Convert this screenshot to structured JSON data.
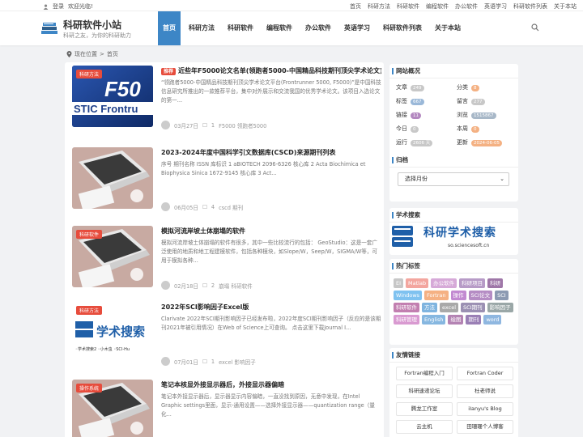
{
  "topbar": {
    "login": "登录",
    "welcome": "欢迎光临!",
    "links": [
      "首页",
      "科研方法",
      "科研软件",
      "编程软件",
      "办公软件",
      "英语学习",
      "科研软件列表",
      "关于本站"
    ]
  },
  "site": {
    "title": "科研软件小站",
    "subtitle": "科研之友，为你的科研助力"
  },
  "nav": [
    "首页",
    "科研方法",
    "科研软件",
    "编程软件",
    "办公软件",
    "英语学习",
    "科研软件列表",
    "关于本站"
  ],
  "breadcrumb": {
    "label": "现在位置",
    "current": "首页"
  },
  "posts": [
    {
      "cat": "科研方法",
      "badge": "推荐",
      "title": "近些年F5000论文名单(领跑者5000-中国精品科技期刊顶尖学术论文)",
      "excerpt": "“领跑者5000-中国精品科技期刊顶尖学术论文平台(Frontrunner 5000, F5000)”是中国科技信息研究所推出的一款推荐平台，集中对外展示和交流我国的优秀学术论文。该项目入选论文的第一...",
      "date": "03月27日",
      "comments": "1",
      "tags": "F5000  领跑者5000",
      "thumb": "f5000"
    },
    {
      "cat": "",
      "badge": "",
      "title": "2023-2024年度中国科学引文数据库(CSCD)来源期刊列表",
      "excerpt": "序号 期刊名称 ISSN 库标识 1 aBIOTECH 2096-6326 核心库 2 Acta Biochimica et Biophysica Sinica 1672-9145 核心库 3 Act...",
      "date": "06月05日",
      "comments": "4",
      "tags": "cscd  期刊",
      "thumb": "laptop"
    },
    {
      "cat": "科研软件",
      "badge": "",
      "title": "模拟河流岸坡土体崩塌的软件",
      "excerpt": "模拟河流岸坡土体崩塌的软件有很多，其中一些比较流行的包括： GeoStudio：这是一套广泛使用的地质和地工程建模软件，包括各种模块，如Slope/W，Seep/W，SIGMA/W等，可用于模拟各种...",
      "date": "02月18日",
      "comments": "2",
      "tags": "崩塌  科研软件",
      "thumb": "laptop"
    },
    {
      "cat": "科研方法",
      "badge": "",
      "title": "2022年SCI影响因子Excel版",
      "excerpt": "Clarivate 2022年SCI期刊影响因子已经发布啦，2022年度SCI期刊影响因子（反应的是该期刊2021年被引用情况）在Web of Science上可查询。 点击这里下载Journal I...",
      "date": "07月01日",
      "comments": "1",
      "tags": "excel  影响因子",
      "thumb": "search"
    },
    {
      "cat": "操作系统",
      "badge": "",
      "title": "笔记本核显外接显示器后，外接显示器偏暗",
      "excerpt": "笔记本外接显示器后，显示器显示内容偏暗，一直没找到原因，无意中发现，在Intel Graphic settings里面，显示-通用设置——选择外接显示器——quantization range（量化...",
      "date": "",
      "comments": "",
      "tags": "",
      "thumb": "laptop"
    }
  ],
  "sidebar": {
    "overview_title": "网站概况",
    "stats": [
      {
        "label": "文章",
        "value": "249"
      },
      {
        "label": "分类",
        "value": "8"
      },
      {
        "label": "标签",
        "value": "667"
      },
      {
        "label": "留言",
        "value": "277"
      },
      {
        "label": "链接",
        "value": "11"
      },
      {
        "label": "浏览",
        "value": "1515867"
      },
      {
        "label": "今日",
        "value": "0"
      },
      {
        "label": "本周",
        "value": "0"
      },
      {
        "label": "运行",
        "value": "2606 天"
      },
      {
        "label": "更新",
        "value": "2024-06-05"
      }
    ],
    "archive_title": "归档",
    "archive_select": "选择月份",
    "search_title": "学术搜索",
    "search_banner": "科研学术搜索",
    "search_url": "so.sciencesoft.cn",
    "tags_title": "热门标签",
    "tags": [
      {
        "t": "EI",
        "c": "#c7c7c7"
      },
      {
        "t": "Matlab",
        "c": "#f3a69f"
      },
      {
        "t": "办公软件",
        "c": "#d6a9d8"
      },
      {
        "t": "科研项目",
        "c": "#b79bc7"
      },
      {
        "t": "科研",
        "c": "#9f77a8"
      },
      {
        "t": "Windows",
        "c": "#7fc2f0"
      },
      {
        "t": "Fortran",
        "c": "#f5b183"
      },
      {
        "t": "操作",
        "c": "#c28ad1"
      },
      {
        "t": "SCI论文",
        "c": "#b58cc4"
      },
      {
        "t": "SCI",
        "c": "#8c9ab2"
      },
      {
        "t": "科研软件",
        "c": "#c27fb0"
      },
      {
        "t": "方法",
        "c": "#7fb4df"
      },
      {
        "t": "excel",
        "c": "#a9a9a9"
      },
      {
        "t": "SCI期刊",
        "c": "#9b90b3"
      },
      {
        "t": "影响因子",
        "c": "#9aa7a7"
      },
      {
        "t": "科研管理",
        "c": "#d99ad1"
      },
      {
        "t": "English",
        "c": "#86b7e0"
      },
      {
        "t": "绘图",
        "c": "#b483b3"
      },
      {
        "t": "期刊",
        "c": "#9a7fb5"
      },
      {
        "t": "word",
        "c": "#8fb7e0"
      }
    ],
    "links_title": "友情链接",
    "links": [
      "Fortran编程入门",
      "Fortran Coder",
      "科研速递论坛",
      "杜老师说",
      "腾龙工作室",
      "iIanyu's Blog",
      "云主机",
      "田珊珊个人博客"
    ]
  },
  "colors": {
    "accent": "#3d86c6",
    "badge": "#e74c3c"
  }
}
